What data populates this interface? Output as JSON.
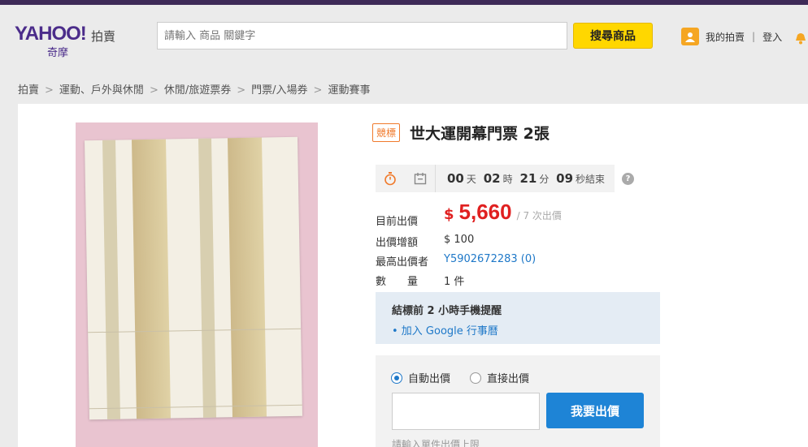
{
  "header": {
    "logo_main": "YAHOO!",
    "logo_sub": "奇摩",
    "logo_auction": "拍賣",
    "search_placeholder": "請輸入 商品 關鍵字",
    "search_button": "搜尋商品",
    "my_auction": "我的拍賣",
    "separator": "|",
    "login": "登入"
  },
  "breadcrumb": [
    "拍賣",
    "運動、戶外與休閒",
    "休閒/旅遊票券",
    "門票/入場券",
    "運動賽事"
  ],
  "breadcrumb_sep": ">",
  "product": {
    "badge": "競標",
    "title": "世大運開幕門票 2張",
    "timer": {
      "days": "00",
      "days_unit": "天",
      "hours": "02",
      "hours_unit": "時",
      "minutes": "21",
      "minutes_unit": "分",
      "seconds": "09",
      "seconds_unit": "秒結束"
    },
    "help": "?",
    "current_price_label": "目前出價",
    "currency": "$",
    "current_price": "5,660",
    "bid_count": "/ 7 次出價",
    "increment_label": "出價增額",
    "increment": "$ 100",
    "top_bidder_label": "最高出價者",
    "top_bidder": "Y5902672283 (0)",
    "quantity_label": "數　　量",
    "quantity": "1 件"
  },
  "reminder": {
    "title": "結標前 2 小時手機提醒",
    "link": "• 加入 Google 行事曆"
  },
  "bid": {
    "auto_bid": "自動出價",
    "direct_bid": "直接出價",
    "button": "我要出價",
    "hint": "請輸入單件出價上限"
  },
  "colors": {
    "brand_purple": "#4b2c8a",
    "price_red": "#e02020",
    "accent_blue": "#1e84d6",
    "search_yellow": "#ffd700"
  }
}
